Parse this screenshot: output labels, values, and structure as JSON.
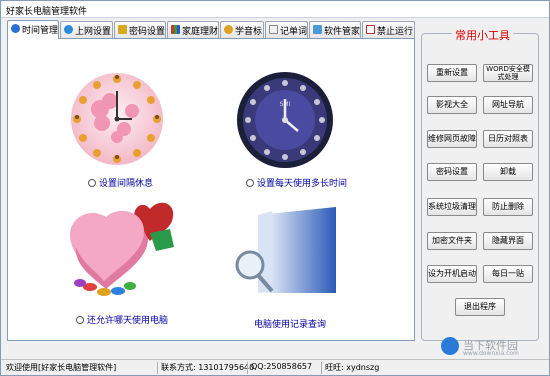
{
  "window": {
    "title": "好家长电脑管理软件"
  },
  "tabs": [
    {
      "label": "时间管理"
    },
    {
      "label": "上网设置"
    },
    {
      "label": "密码设置"
    },
    {
      "label": "家庭理财"
    },
    {
      "label": "学音标"
    },
    {
      "label": "记单词"
    },
    {
      "label": "软件管家"
    },
    {
      "label": "禁止运行"
    }
  ],
  "features": {
    "rest": {
      "label": "设置间隔休息"
    },
    "daily_limit": {
      "label": "设置每天使用多长时间"
    },
    "allowed_days": {
      "label": "还允许哪天使用电脑"
    },
    "log": {
      "label": "电脑使用记录查询"
    }
  },
  "clock": {
    "brand": "SMI"
  },
  "tools": {
    "title": "常用小工具",
    "buttons": [
      {
        "label": "重新设置"
      },
      {
        "label": "WORD安全模式处理"
      },
      {
        "label": "影视大全"
      },
      {
        "label": "网址导航"
      },
      {
        "label": "维修网页故障"
      },
      {
        "label": "日历对照表"
      },
      {
        "label": "密码设置"
      },
      {
        "label": "卸载"
      },
      {
        "label": "系统垃圾清理"
      },
      {
        "label": "防止删除"
      },
      {
        "label": "加密文件夹"
      },
      {
        "label": "隐藏界面"
      },
      {
        "label": "设为开机启动"
      },
      {
        "label": "每日一贴"
      },
      {
        "label": "退出程序"
      }
    ]
  },
  "status": {
    "welcome": "欢迎使用[好家长电脑管理软件]",
    "contact": "联系方式: 13101795640",
    "qq": "QQ:250858657",
    "wangwang": "旺旺: xydnszg"
  },
  "watermark": {
    "text": "当下软件园",
    "url": "www.downxia.com"
  }
}
